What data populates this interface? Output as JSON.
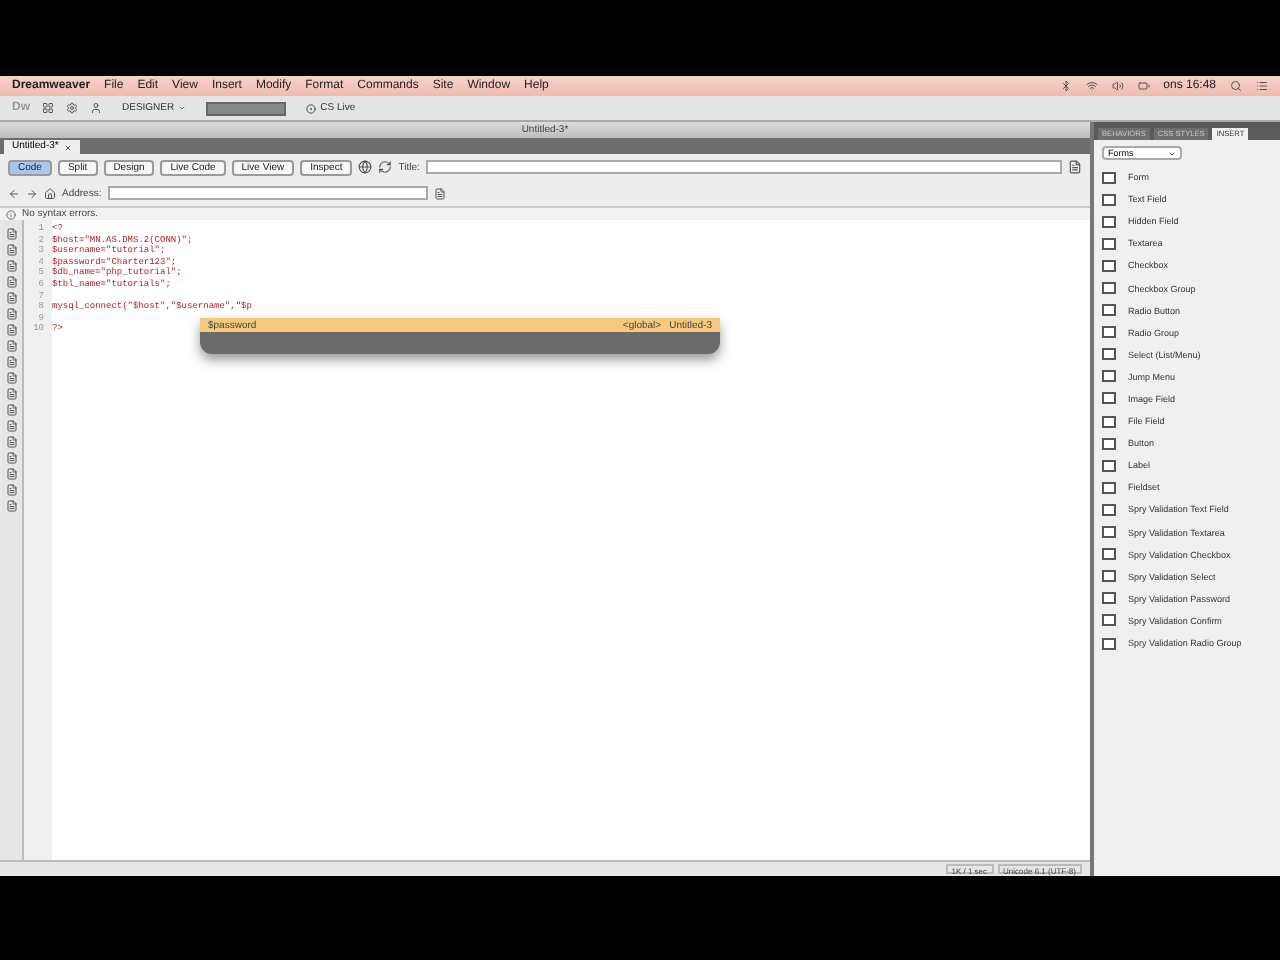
{
  "menu_bar": {
    "app": "Dreamweaver",
    "items": [
      "File",
      "Edit",
      "View",
      "Insert",
      "Modify",
      "Format",
      "Commands",
      "Site",
      "Window",
      "Help"
    ],
    "clock": "ons 16:48"
  },
  "app_bar": {
    "logo": "Dw",
    "workspace": "DESIGNER",
    "cs_live": "CS Live"
  },
  "document": {
    "window_title": "Untitled-3*",
    "tab": "Untitled-3*",
    "view_buttons": [
      {
        "label": "Code",
        "selected": true
      },
      {
        "label": "Split",
        "selected": false
      },
      {
        "label": "Design",
        "selected": false
      }
    ],
    "tool_buttons": [
      "Live Code",
      "Live View",
      "Inspect"
    ],
    "title_label": "Title:",
    "address_label": "Address:",
    "status": "No syntax errors.",
    "code_lines": [
      {
        "number": "1",
        "text": "<?"
      },
      {
        "number": "2",
        "text": "$host=\"MN.AS.DMS.2(CONN)\";"
      },
      {
        "number": "3",
        "text": "$username=\"tutorial\";"
      },
      {
        "number": "4",
        "text": "$password=\"Charter123\";"
      },
      {
        "number": "5",
        "text": "$db_name=\"php_tutorial\";"
      },
      {
        "number": "6",
        "text": "$tbl_name=\"tutorials\";"
      },
      {
        "number": "7"
      },
      {
        "number": "8",
        "text": "mysql_connect(\"$host\",\"$username\",\"$p"
      },
      {
        "number": "9"
      },
      {
        "number": "10",
        "text": "?>"
      }
    ],
    "autocomplete": {
      "name": "$password",
      "scope": "<global>",
      "file": "Untitled-3"
    },
    "footer": [
      "1K / 1 sec",
      "Unicode 6.1 (UTF-8)"
    ]
  },
  "panel": {
    "tabs": [
      {
        "label": "BEHAVIORS",
        "selected": false
      },
      {
        "label": "CSS STYLES",
        "selected": false
      },
      {
        "label": "INSERT",
        "selected": true
      }
    ],
    "category": "Forms",
    "items": [
      "Form",
      "Text Field",
      "Hidden Field",
      "Textarea",
      "Checkbox",
      "Checkbox Group",
      "Radio Button",
      "Radio Group",
      "Select (List/Menu)",
      "Jump Menu",
      "Image Field",
      "File Field",
      "Button",
      "Label",
      "Fieldset",
      "Spry Validation Text Field",
      "Spry Validation Textarea",
      "Spry Validation Checkbox",
      "Spry Validation Select",
      "Spry Validation Password",
      "Spry Validation Confirm",
      "Spry Validation Radio Group"
    ]
  }
}
